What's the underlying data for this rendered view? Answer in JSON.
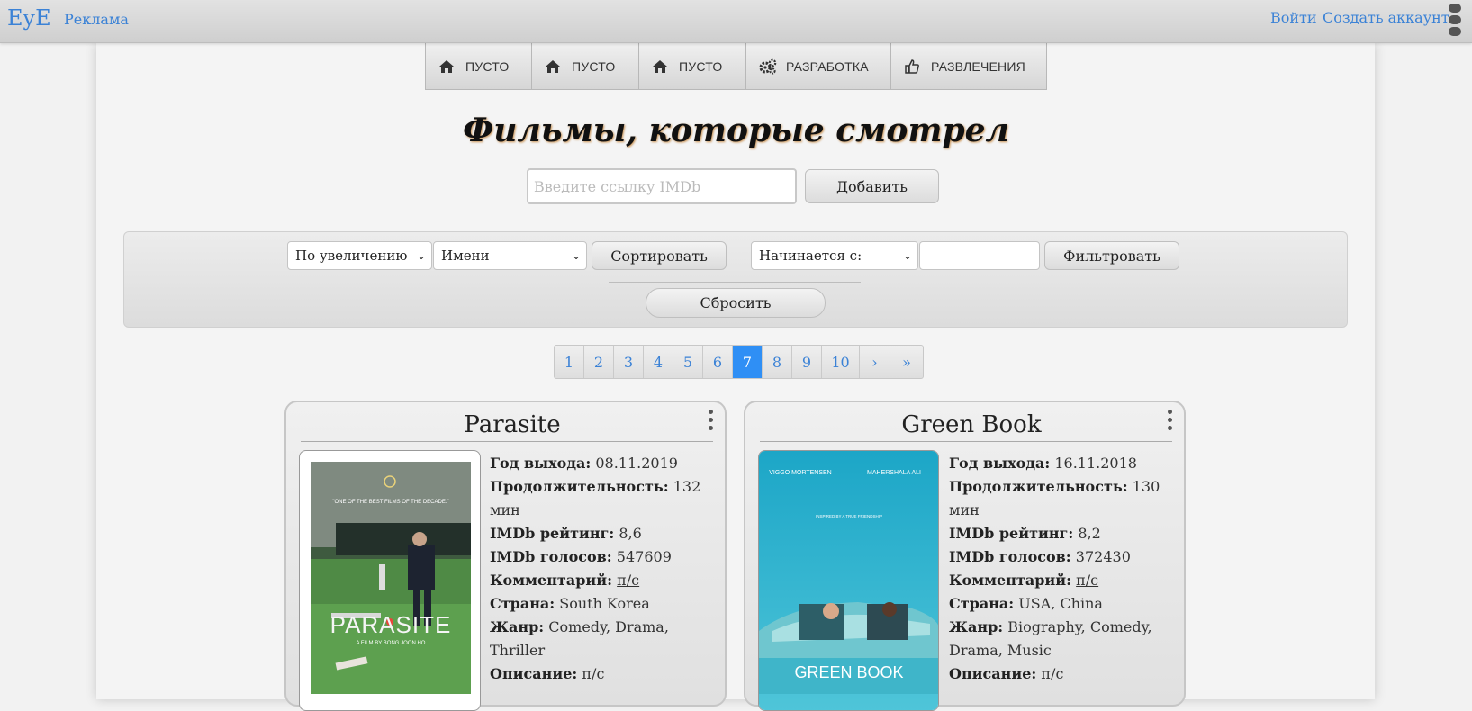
{
  "topbar": {
    "logo": "EyE",
    "ads": "Реклама",
    "login": "Войти",
    "signup": "Создать аккаунт"
  },
  "nav": [
    {
      "label": "ПУСТО",
      "icon": "home-icon"
    },
    {
      "label": "ПУСТО",
      "icon": "home-icon"
    },
    {
      "label": "ПУСТО",
      "icon": "home-icon"
    },
    {
      "label": "РАЗРАБОТКА",
      "icon": "gears-icon"
    },
    {
      "label": "РАЗВЛЕЧЕНИЯ",
      "icon": "thumbs-up-icon"
    }
  ],
  "page": {
    "title": "Фильмы, которые смотрел",
    "imdb_placeholder": "Введите ссылку IMDb",
    "add_button": "Добавить"
  },
  "filters": {
    "order": "По увеличению",
    "sort_by": "Имени",
    "sort_button": "Сортировать",
    "filter_mode": "Начинается с:",
    "filter_value": "",
    "filter_button": "Фильтровать",
    "reset_button": "Сбросить"
  },
  "pagination": {
    "pages": [
      "1",
      "2",
      "3",
      "4",
      "5",
      "6",
      "7",
      "8",
      "9",
      "10"
    ],
    "current": "7",
    "next": "›",
    "last": "»"
  },
  "labels": {
    "year": "Год выхода:",
    "duration": "Продолжительность:",
    "rating": "IMDb рейтинг:",
    "votes": "IMDb голосов:",
    "comment": "Комментарий:",
    "country": "Страна:",
    "genre": "Жанр:",
    "description": "Описание:"
  },
  "movies": [
    {
      "title": "Parasite",
      "year": "08.11.2019",
      "duration": "132 мин",
      "rating": "8,6",
      "votes": "547609",
      "comment": "п/с",
      "country": "South Korea",
      "genre": "Comedy, Drama, Thriller",
      "description": "п/с",
      "poster_title": "PARASITE",
      "poster_tagline": "\"ONE OF THE BEST FILMS OF THE DECADE.\"",
      "poster_credit": "A FILM BY BONG JOON HO"
    },
    {
      "title": "Green Book",
      "year": "16.11.2018",
      "duration": "130 мин",
      "rating": "8,2",
      "votes": "372430",
      "comment": "п/с",
      "country": "USA, China",
      "genre": "Biography, Comedy, Drama, Music",
      "description": "п/с",
      "poster_title": "GREEN BOOK",
      "poster_actor_1": "VIGGO MORTENSEN",
      "poster_actor_2": "MAHERSHALA ALI",
      "poster_tagline": "INSPIRED BY A TRUE FRIENDSHIP"
    }
  ]
}
